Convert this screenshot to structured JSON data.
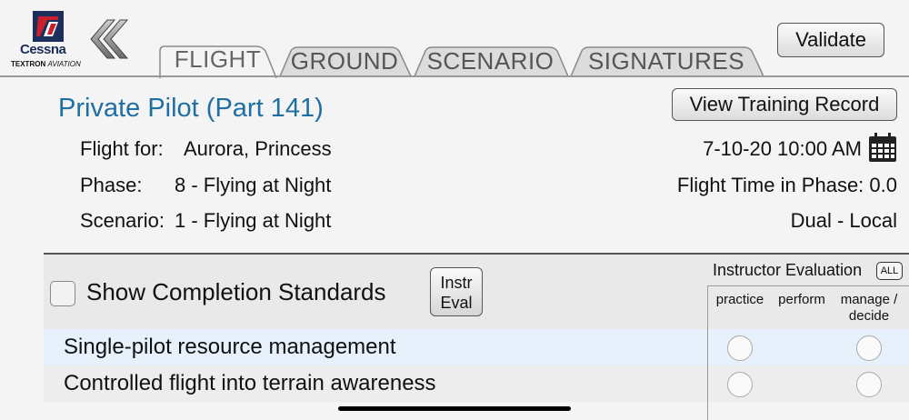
{
  "logo": {
    "brand": "Cessna",
    "sub_bold": "TEXTRON",
    "sub_italic": "AVIATION"
  },
  "tabs": [
    {
      "label": "FLIGHT",
      "active": true
    },
    {
      "label": "GROUND",
      "active": false
    },
    {
      "label": "SCENARIO",
      "active": false
    },
    {
      "label": "SIGNATURES",
      "active": false
    }
  ],
  "header": {
    "validate_label": "Validate",
    "view_record_label": "View Training Record",
    "title": "Private Pilot (Part 141)"
  },
  "details": {
    "flight_for_label": "Flight for:",
    "flight_for_value": "Aurora, Princess",
    "phase_label": "Phase:",
    "phase_value": "8 - Flying at Night",
    "scenario_label": "Scenario:",
    "scenario_value": "1 - Flying at Night",
    "datetime": "7-10-20 10:00 AM",
    "flight_time": "Flight Time in Phase: 0.0",
    "type": "Dual - Local"
  },
  "table": {
    "show_cs_label": "Show Completion Standards",
    "instr_line1": "Instr",
    "instr_line2": "Eval",
    "instructor_eval_label": "Instructor Evaluation",
    "all_label": "ALL",
    "columns": {
      "practice": "practice",
      "perform": "perform",
      "manage_line1": "manage /",
      "manage_line2": "decide"
    },
    "rows": [
      {
        "label": "Single-pilot resource management"
      },
      {
        "label": "Controlled flight into terrain awareness"
      }
    ]
  },
  "colors": {
    "title_blue": "#1f6fa3",
    "row_highlight": "#e6f1fb",
    "cessna_red": "#c8202f",
    "cessna_blue": "#1b2f5a"
  },
  "icons": [
    "cessna-logo-icon",
    "back-chevron-icon",
    "calendar-icon"
  ]
}
